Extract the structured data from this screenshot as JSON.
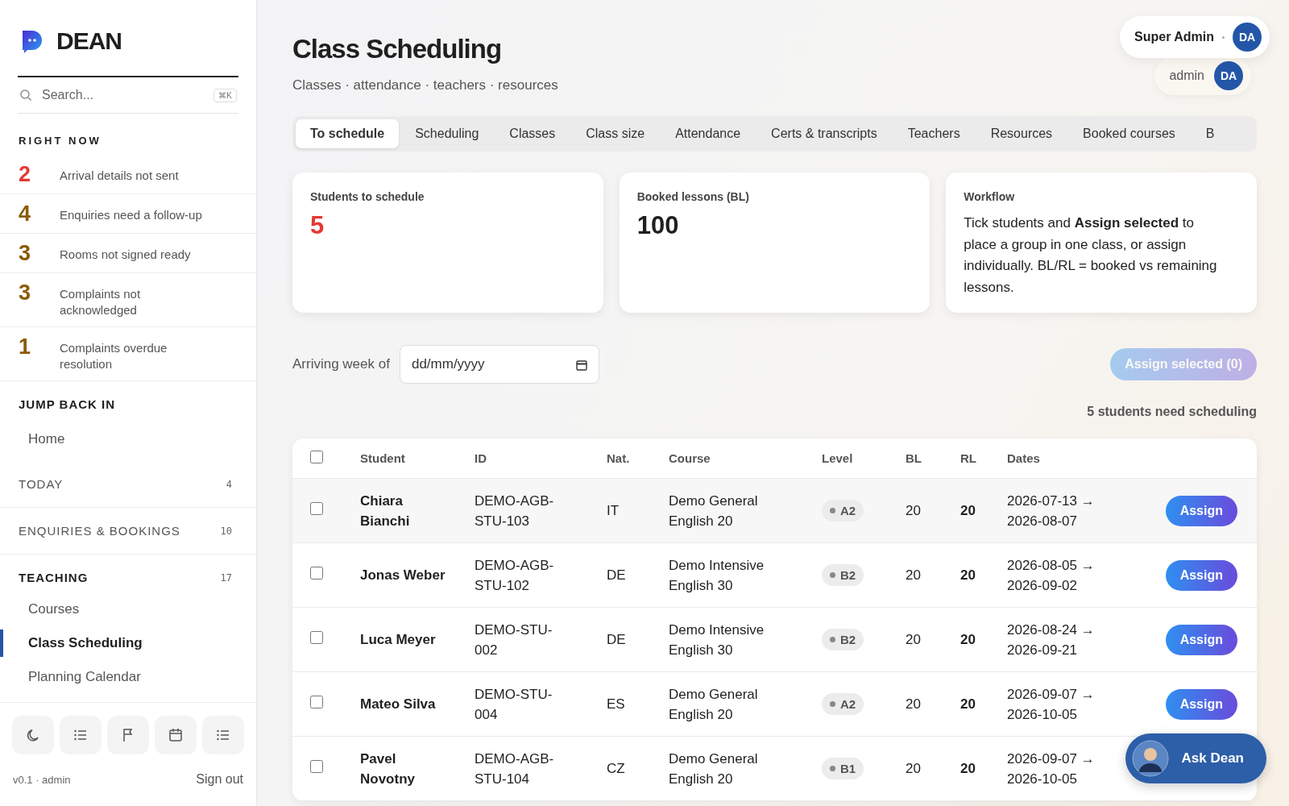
{
  "sidebar": {
    "brand": "DEAN",
    "search": {
      "placeholder": "Search...",
      "shortcut": "⌘K"
    },
    "right_now": {
      "title": "RIGHT NOW",
      "items": [
        {
          "count": "2",
          "label": "Arrival details not sent",
          "color": "#e53935"
        },
        {
          "count": "4",
          "label": "Enquiries need a follow-up",
          "color": "#8a5a00"
        },
        {
          "count": "3",
          "label": "Rooms not signed ready",
          "color": "#8a5a00"
        },
        {
          "count": "3",
          "label": "Complaints not acknowledged",
          "color": "#8a5a00"
        },
        {
          "count": "1",
          "label": "Complaints overdue resolution",
          "color": "#8a5a00"
        }
      ]
    },
    "jump_back": {
      "title": "JUMP BACK IN",
      "items": [
        {
          "label": "Home",
          "selected": false
        }
      ]
    },
    "sections": [
      {
        "title": "TODAY",
        "count": "4",
        "expanded": false
      },
      {
        "title": "ENQUIRIES & BOOKINGS",
        "count": "10",
        "expanded": false
      },
      {
        "title": "TEACHING",
        "count": "17",
        "expanded": true,
        "items": [
          {
            "label": "Courses",
            "selected": false
          },
          {
            "label": "Class Scheduling",
            "selected": true
          },
          {
            "label": "Planning Calendar",
            "selected": false
          }
        ]
      }
    ],
    "version": "v0.1 · admin",
    "sign_out": "Sign out"
  },
  "header": {
    "title": "Class Scheduling",
    "subtitle": "Classes · attendance · teachers · resources"
  },
  "user_menu": {
    "name": "Super Admin",
    "initials": "DA",
    "role": "admin",
    "role_initials": "DA"
  },
  "tabs": [
    {
      "label": "To schedule",
      "selected": true
    },
    {
      "label": "Scheduling",
      "selected": false
    },
    {
      "label": "Classes",
      "selected": false
    },
    {
      "label": "Class size",
      "selected": false
    },
    {
      "label": "Attendance",
      "selected": false
    },
    {
      "label": "Certs & transcripts",
      "selected": false
    },
    {
      "label": "Teachers",
      "selected": false
    },
    {
      "label": "Resources",
      "selected": false
    },
    {
      "label": "Booked courses",
      "selected": false
    },
    {
      "label": "B",
      "selected": false
    }
  ],
  "cards": [
    {
      "kind": "stat",
      "title": "Students to schedule",
      "value": "5",
      "color": "#e53935"
    },
    {
      "kind": "stat",
      "title": "Booked lessons (BL)",
      "value": "100",
      "color": "#1f1f1f"
    },
    {
      "kind": "text",
      "title": "Workflow",
      "text": "Tick students and **Assign selected** to place a group in one class, or assign individually. BL/RL = booked vs remaining lessons."
    }
  ],
  "filter": {
    "label": "Arriving week of",
    "placeholder": "dd/mm/yyyy"
  },
  "assign_selected": {
    "label": "Assign selected (0)",
    "disabled": true
  },
  "summary": "5 students need scheduling",
  "table": {
    "all_checked": false,
    "columns": [
      "Student",
      "ID",
      "Nat.",
      "Course",
      "Level",
      "BL",
      "RL",
      "Dates"
    ],
    "rows": [
      {
        "checked": false,
        "student": "Chiara Bianchi",
        "id": "DEMO-AGB-STU-103",
        "nat": "IT",
        "course": "Demo General English 20",
        "level": "A2",
        "bl": "20",
        "rl": "20",
        "dates": "2026-07-13 → 2026-08-07",
        "action": "Assign"
      },
      {
        "checked": false,
        "student": "Jonas Weber",
        "id": "DEMO-AGB-STU-102",
        "nat": "DE",
        "course": "Demo Intensive English 30",
        "level": "B2",
        "bl": "20",
        "rl": "20",
        "dates": "2026-08-05 → 2026-09-02",
        "action": "Assign"
      },
      {
        "checked": false,
        "student": "Luca Meyer",
        "id": "DEMO-STU-002",
        "nat": "DE",
        "course": "Demo Intensive English 30",
        "level": "B2",
        "bl": "20",
        "rl": "20",
        "dates": "2026-08-24 → 2026-09-21",
        "action": "Assign"
      },
      {
        "checked": false,
        "student": "Mateo Silva",
        "id": "DEMO-STU-004",
        "nat": "ES",
        "course": "Demo General English 20",
        "level": "A2",
        "bl": "20",
        "rl": "20",
        "dates": "2026-09-07 → 2026-10-05",
        "action": "Assign"
      },
      {
        "checked": false,
        "student": "Pavel Novotny",
        "id": "DEMO-AGB-STU-104",
        "nat": "CZ",
        "course": "Demo General English 20",
        "level": "B1",
        "bl": "20",
        "rl": "20",
        "dates": "2026-09-07 → 2026-10-05"
      }
    ]
  },
  "assistant": {
    "label": "Ask Dean"
  }
}
